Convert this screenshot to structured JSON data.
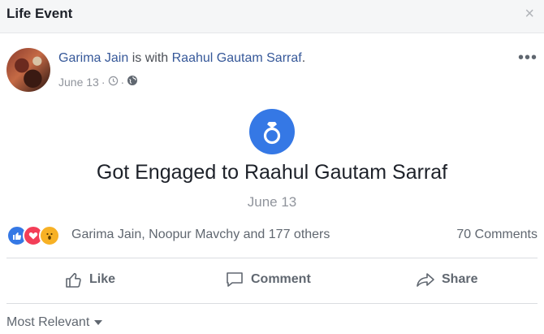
{
  "header": {
    "title": "Life Event",
    "close_glyph": "×"
  },
  "post": {
    "author": "Garima Jain",
    "connector": "is with",
    "tagged": "Raahul Gautam Sarraf",
    "period": ".",
    "date": "June 13",
    "separator": "·",
    "icons": [
      "clock-icon",
      "globe-icon"
    ],
    "more_glyph": "•••"
  },
  "life_event": {
    "icon": "ring-icon",
    "title": "Got Engaged to Raahul Gautam Sarraf",
    "date": "June 13"
  },
  "reactions": {
    "types": [
      "like",
      "love",
      "wow"
    ],
    "names": "Garima Jain, Noopur Mavchy and 177 others",
    "comments": "70 Comments"
  },
  "actions": {
    "like": "Like",
    "comment": "Comment",
    "share": "Share"
  },
  "sort": {
    "label": "Most Relevant"
  },
  "colors": {
    "accent": "#3578e5",
    "link": "#365899",
    "love": "#f33e58",
    "wow": "#f7b125"
  }
}
